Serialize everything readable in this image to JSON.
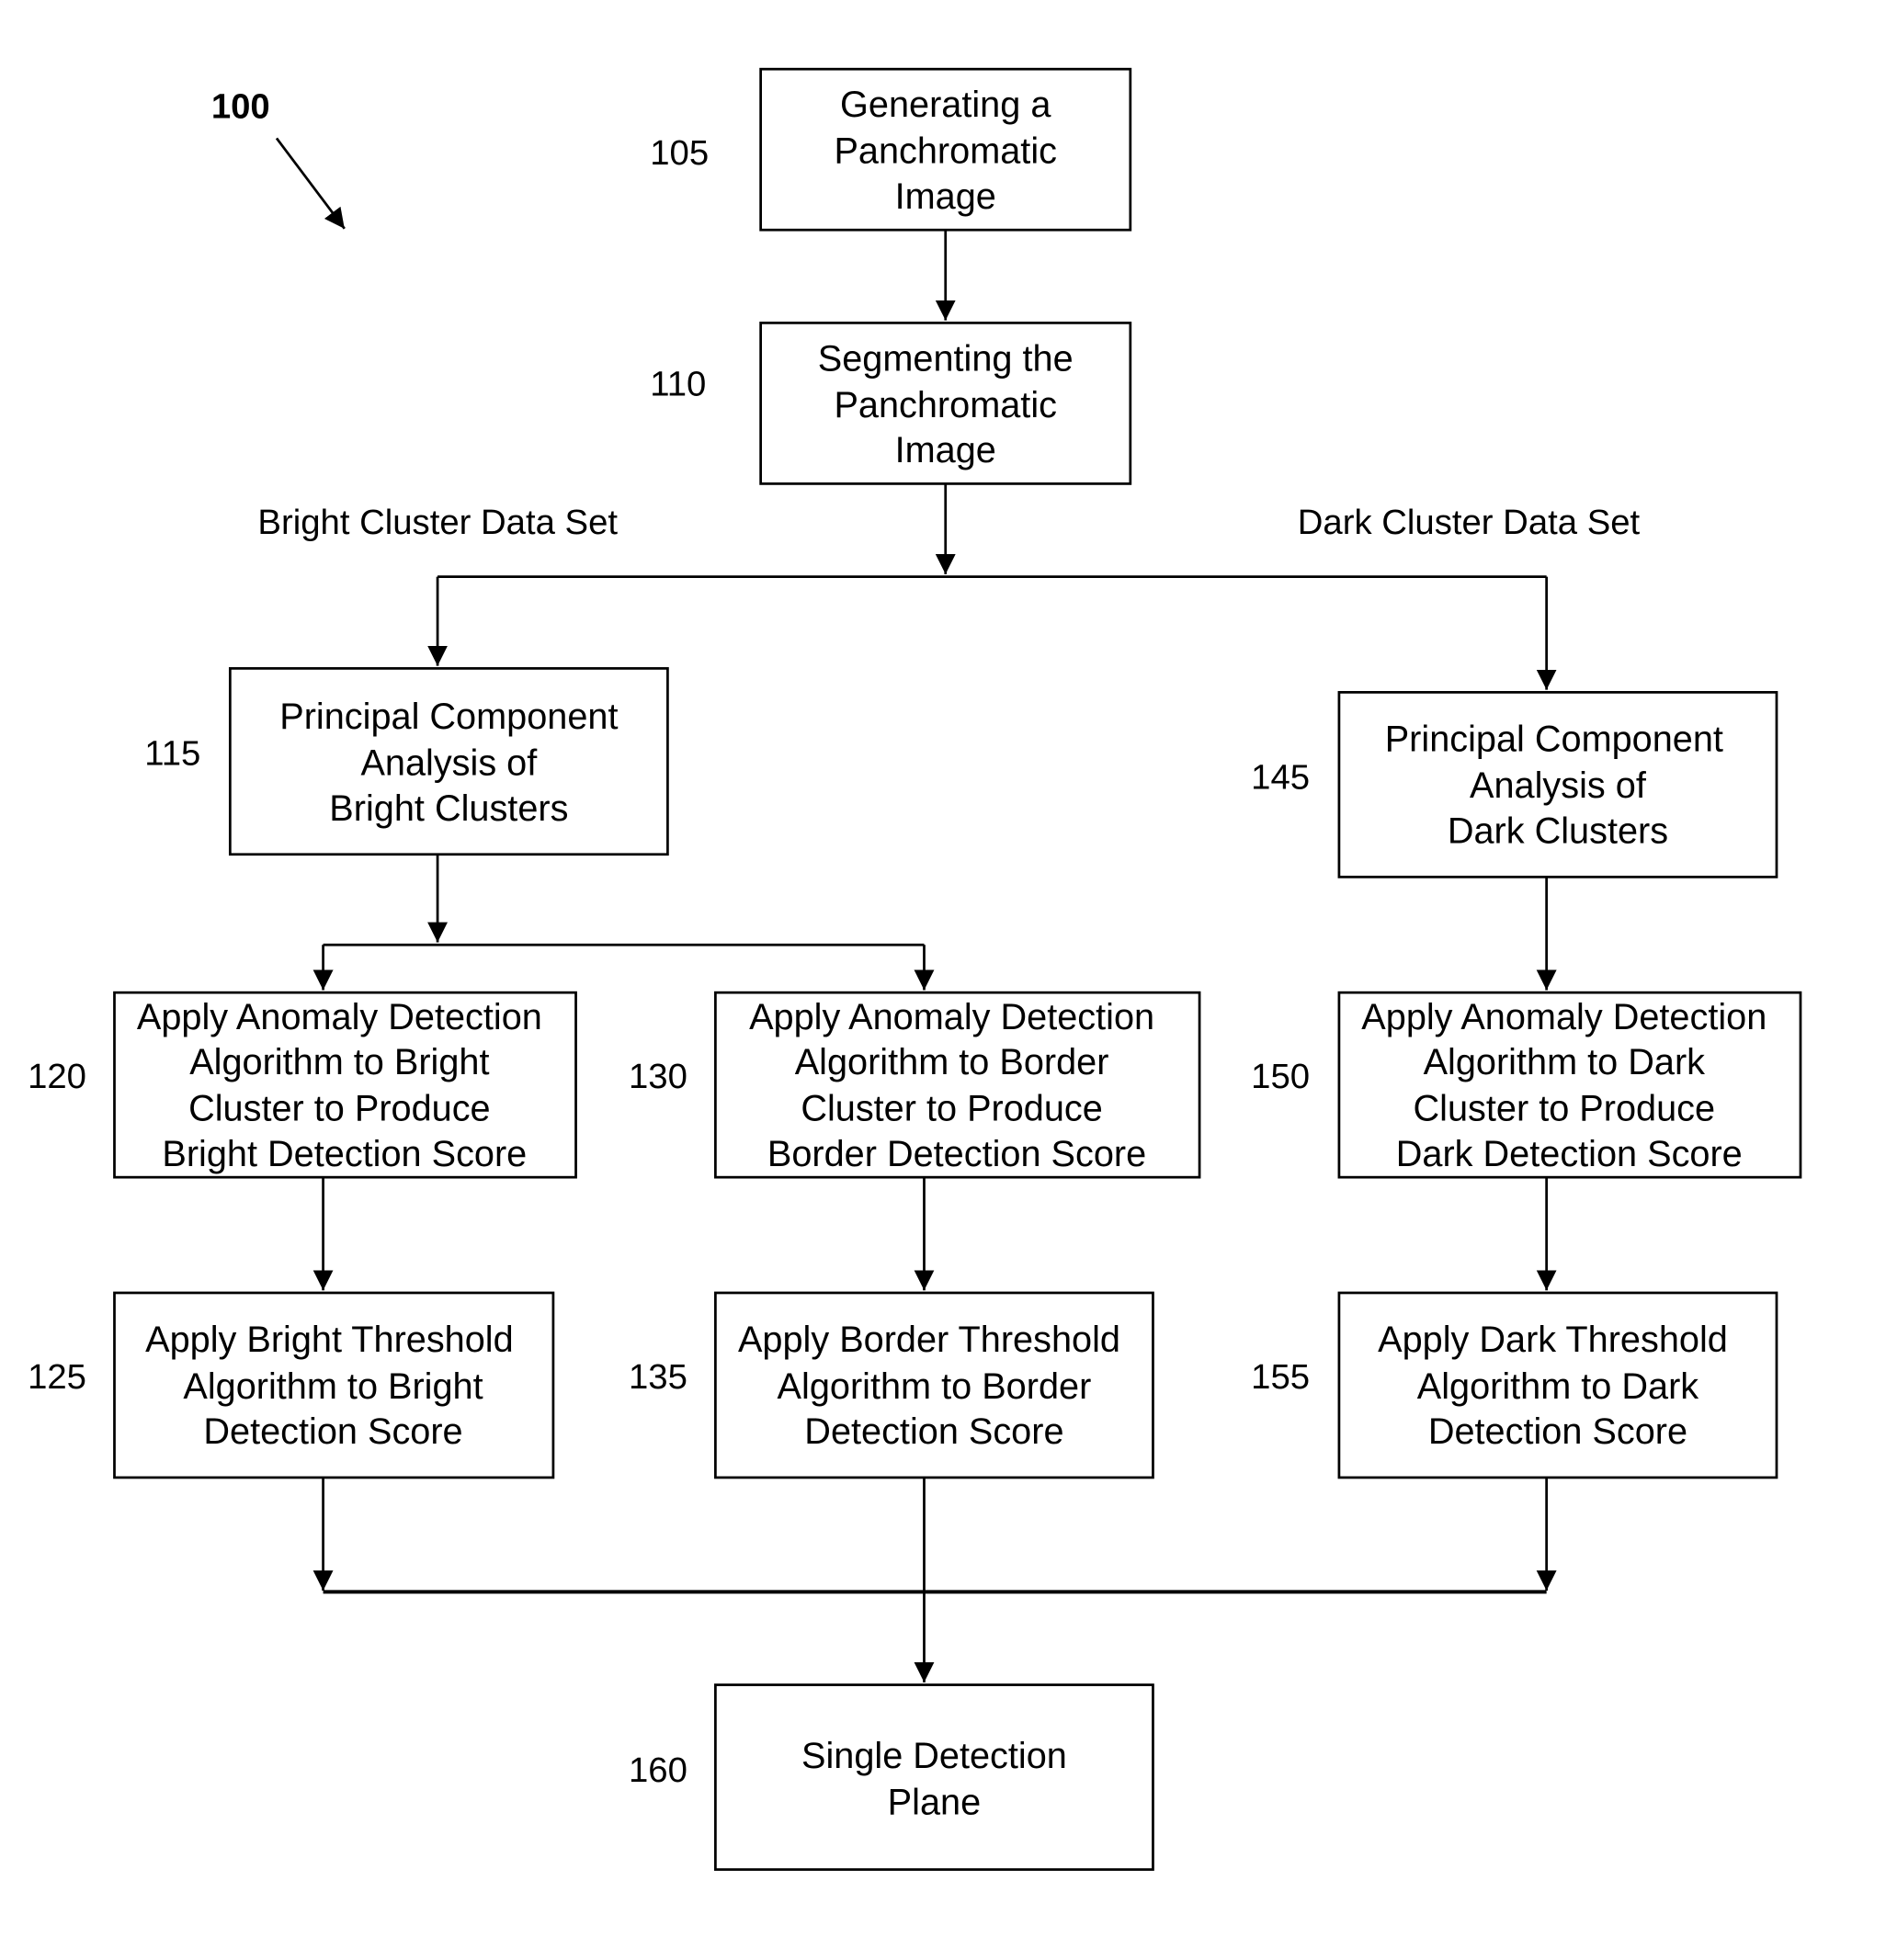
{
  "figure_label": "100",
  "set_labels": {
    "bright": "Bright Cluster Data Set",
    "dark": "Dark Cluster Data Set"
  },
  "steps": {
    "s105": {
      "ref": "105",
      "lines": [
        "Generating a",
        "Panchromatic",
        "Image"
      ]
    },
    "s110": {
      "ref": "110",
      "lines": [
        "Segmenting the",
        "Panchromatic",
        "Image"
      ]
    },
    "s115": {
      "ref": "115",
      "lines": [
        "Principal Component",
        "Analysis of",
        "Bright Clusters"
      ]
    },
    "s145": {
      "ref": "145",
      "lines": [
        "Principal Component",
        "Analysis of",
        "Dark Clusters"
      ]
    },
    "s120": {
      "ref": "120",
      "lines": [
        "Apply Anomaly Detection",
        "Algorithm to Bright",
        "Cluster to Produce",
        "Bright Detection Score"
      ]
    },
    "s130": {
      "ref": "130",
      "lines": [
        "Apply Anomaly Detection",
        "Algorithm to Border",
        "Cluster to Produce",
        "Border Detection Score"
      ]
    },
    "s150": {
      "ref": "150",
      "lines": [
        "Apply Anomaly Detection",
        "Algorithm to Dark",
        "Cluster to Produce",
        "Dark Detection Score"
      ]
    },
    "s125": {
      "ref": "125",
      "lines": [
        "Apply Bright Threshold",
        "Algorithm to Bright",
        "Detection Score"
      ]
    },
    "s135": {
      "ref": "135",
      "lines": [
        "Apply Border Threshold",
        "Algorithm to Border",
        "Detection Score"
      ]
    },
    "s155": {
      "ref": "155",
      "lines": [
        "Apply Dark Threshold",
        "Algorithm to Dark",
        "Detection Score"
      ]
    },
    "s160": {
      "ref": "160",
      "lines": [
        "Single Detection",
        "Plane"
      ]
    }
  }
}
